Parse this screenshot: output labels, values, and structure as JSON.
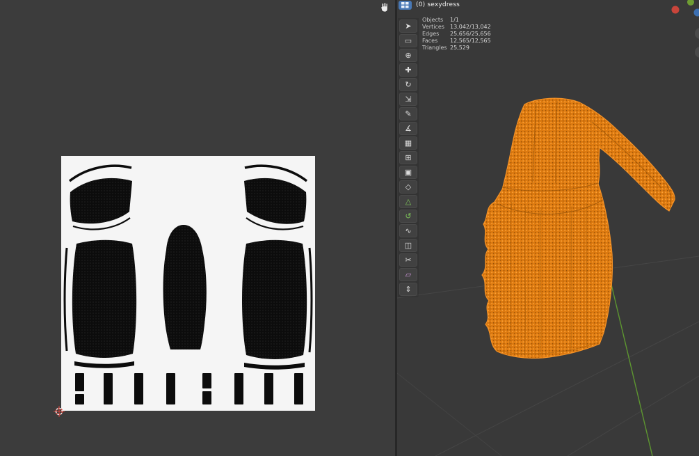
{
  "viewport": {
    "object_label": "(0) sexydress",
    "editor_icon": "uv-grid-icon",
    "mesh_name": "sexydress"
  },
  "stats": {
    "rows": [
      {
        "label": "Objects",
        "value": "1/1"
      },
      {
        "label": "Vertices",
        "value": "13,042/13,042"
      },
      {
        "label": "Edges",
        "value": "25,656/25,656"
      },
      {
        "label": "Faces",
        "value": "12,565/12,565"
      },
      {
        "label": "Triangles",
        "value": "25,529"
      }
    ]
  },
  "toolbar": {
    "tools": [
      {
        "name": "tweak",
        "icon": "tweak-arrow-icon",
        "glyph": "➤"
      },
      {
        "name": "select-box",
        "icon": "select-box-icon",
        "glyph": "▭"
      },
      {
        "name": "cursor",
        "icon": "cursor-target-icon",
        "glyph": "⊕"
      },
      {
        "name": "move",
        "icon": "move-cross-icon",
        "glyph": "✚"
      },
      {
        "name": "rotate",
        "icon": "rotate-arrow-icon",
        "glyph": "↻"
      },
      {
        "name": "scale",
        "icon": "scale-corner-icon",
        "glyph": "⇲"
      },
      {
        "name": "annotate",
        "icon": "pencil-icon",
        "glyph": "✎"
      },
      {
        "name": "measure",
        "icon": "angle-measure-icon",
        "glyph": "∡"
      },
      {
        "name": "add-cube",
        "icon": "add-cube-icon",
        "glyph": "▦"
      },
      {
        "name": "extrude",
        "icon": "extrude-icon",
        "glyph": "⊞"
      },
      {
        "name": "inset-faces",
        "icon": "inset-icon",
        "glyph": "▣"
      },
      {
        "name": "bevel",
        "icon": "bevel-icon",
        "glyph": "◇"
      },
      {
        "name": "poly-build",
        "icon": "poly-build-icon",
        "glyph": "△"
      },
      {
        "name": "spin",
        "icon": "spin-arrow-icon",
        "glyph": "↺"
      },
      {
        "name": "smooth",
        "icon": "smooth-wave-icon",
        "glyph": "∿"
      },
      {
        "name": "loop-cut",
        "icon": "loop-cut-icon",
        "glyph": "◫"
      },
      {
        "name": "knife",
        "icon": "knife-scissors-icon",
        "glyph": "✂"
      },
      {
        "name": "shear",
        "icon": "shear-icon",
        "glyph": "▱"
      },
      {
        "name": "shrink-fatten",
        "icon": "shrink-fatten-icon",
        "glyph": "⇕"
      }
    ]
  },
  "uv_editor": {
    "islands": [
      "bodice-left-strap",
      "bodice-left",
      "bodice-right-strap",
      "bodice-right",
      "skirt-panel-left",
      "sleeve",
      "skirt-panel-right",
      "hem-strip-left",
      "hem-strip-right",
      "waistband-bar-1",
      "waistband-bar-2",
      "waistband-bar-3",
      "waistband-bar-4",
      "waistband-bar-5",
      "waistband-bar-6",
      "waistband-bar-7",
      "waistband-bar-8"
    ]
  },
  "colors": {
    "mesh_selected_orange": "#DD7A10",
    "mesh_highlight": "#FFA63A",
    "axis_green": "#5D9630",
    "editor_button_blue": "#4878B5",
    "gizmo_x_red": "#C9453B",
    "gizmo_y_green": "#6F9D33",
    "gizmo_z_blue": "#3C6FB1",
    "uv_image_white": "#F5F5F5",
    "uv_island_black": "#0C0C0C",
    "viewport_bg": "#393939"
  }
}
